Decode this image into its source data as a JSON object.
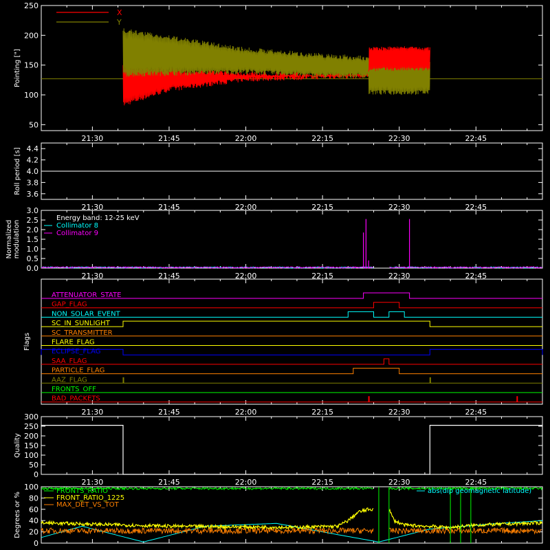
{
  "time_ticks": [
    "21:30",
    "21:45",
    "22:00",
    "22:15",
    "22:30",
    "22:45"
  ],
  "chart_data": [
    {
      "id": "pointing",
      "type": "line",
      "ylabel": "Pointing [\"]",
      "yticks": [
        50,
        100,
        150,
        200,
        250
      ],
      "ylim": [
        40,
        250
      ],
      "legend": [
        {
          "label": "X",
          "color": "#ff0000"
        },
        {
          "label": "Y",
          "color": "#808000"
        }
      ],
      "baseline_value": 127,
      "data_window": [
        "21:36",
        "22:36"
      ],
      "envelope": {
        "x": [
          "21:36",
          "21:45",
          "22:00",
          "22:15",
          "22:24",
          "22:24",
          "22:31",
          "22:36"
        ],
        "X_min": [
          80,
          105,
          122,
          126,
          128,
          140,
          140,
          140
        ],
        "X_max": [
          150,
          145,
          140,
          138,
          140,
          180,
          182,
          180
        ],
        "Y_min": [
          130,
          132,
          135,
          128,
          128,
          100,
          100,
          100
        ],
        "Y_max": [
          212,
          200,
          180,
          170,
          165,
          160,
          158,
          158
        ]
      }
    },
    {
      "id": "roll",
      "type": "line",
      "ylabel": "Roll period [s]",
      "yticks": [
        "3.6",
        "3.8",
        "4.0",
        "4.2",
        "4.4"
      ],
      "ylim": [
        3.5,
        4.5
      ],
      "series": [
        {
          "values_x": [
            "21:20",
            "22:58"
          ],
          "values_y": [
            4.0,
            4.0
          ],
          "color": "#ffffff"
        }
      ]
    },
    {
      "id": "modulation",
      "type": "line",
      "ylabel": "Normalized modulation",
      "yticks": [
        "0.0",
        "0.5",
        "1.0",
        "1.5",
        "2.0",
        "2.5",
        "3.0"
      ],
      "ylim": [
        0,
        3
      ],
      "legend": [
        {
          "label": "Energy band: 12-25 keV",
          "color": "#ffffff"
        },
        {
          "label": "Collimator 8",
          "color": "#00ffff"
        },
        {
          "label": "Collimator 9",
          "color": "#ff00ff"
        }
      ],
      "spikes": [
        {
          "x": "22:23",
          "y": 1.85,
          "color": "#ff00ff"
        },
        {
          "x": "22:23.5",
          "y": 2.55,
          "color": "#ff00ff"
        },
        {
          "x": "22:24",
          "y": 0.4,
          "color": "#ff00ff"
        },
        {
          "x": "22:32",
          "y": 2.55,
          "color": "#ff00ff"
        }
      ],
      "gap": [
        "22:25",
        "22:28"
      ],
      "noise_level": 0.05
    },
    {
      "id": "flags",
      "type": "line",
      "ylabel": "Flags",
      "rows": [
        {
          "label": "ATTENUATOR_STATE",
          "color": "#ff00ff",
          "high": [
            [
              "22:23",
              "22:32"
            ]
          ]
        },
        {
          "label": "GAP_FLAG",
          "color": "#ff0000",
          "high": [
            [
              "22:25",
              "22:30"
            ]
          ]
        },
        {
          "label": "NON_SOLAR_EVENT",
          "color": "#00ffff",
          "high": [
            [
              "22:20",
              "22:25"
            ],
            [
              "22:28",
              "22:31"
            ]
          ]
        },
        {
          "label": "SC_IN_SUNLIGHT",
          "color": "#ffff00",
          "high": [
            [
              "21:36",
              "22:36"
            ]
          ]
        },
        {
          "label": "SC_TRANSMITTER",
          "color": "#ff8000",
          "high": []
        },
        {
          "label": "FLARE_FLAG",
          "color": "#ffff00",
          "high": []
        },
        {
          "label": "ECLIPSE_FLAG",
          "color": "#0000ff",
          "high": [
            [
              "21:20",
              "21:36"
            ],
            [
              "22:36",
              "22:58"
            ]
          ]
        },
        {
          "label": "SAA_FLAG",
          "color": "#ff0000",
          "high": [
            [
              "22:27",
              "22:28"
            ]
          ]
        },
        {
          "label": "PARTICLE_FLAG",
          "color": "#ff8000",
          "high": [
            [
              "22:21",
              "22:30"
            ]
          ]
        },
        {
          "label": "AAZ_FLAG",
          "color": "#808000",
          "pulses": [
            "21:36",
            "22:36"
          ]
        },
        {
          "label": "FRONTS_OFF",
          "color": "#00ff00",
          "high": []
        },
        {
          "label": "BAD_PACKETS",
          "color": "#ff0000",
          "pulses": [
            "22:24",
            "22:53"
          ]
        }
      ]
    },
    {
      "id": "quality",
      "type": "line",
      "ylabel": "Quality",
      "yticks": [
        0,
        50,
        100,
        150,
        200,
        250,
        300
      ],
      "ylim": [
        0,
        300
      ],
      "series": [
        {
          "values_x": [
            "21:20",
            "21:36",
            "21:36",
            "22:36",
            "22:36",
            "22:58"
          ],
          "values_y": [
            255,
            255,
            0,
            0,
            255,
            255
          ],
          "color": "#ffffff"
        }
      ]
    },
    {
      "id": "degrees",
      "type": "line",
      "ylabel": "Degrees or %",
      "yticks": [
        0,
        20,
        40,
        60,
        80,
        100
      ],
      "ylim": [
        0,
        100
      ],
      "legend": [
        {
          "label": "FRONTS_RATIO",
          "color": "#00ff00"
        },
        {
          "label": "FRONT_RATIO_1225",
          "color": "#ffff00"
        },
        {
          "label": "MAX_DET_VS_TOT",
          "color": "#ff8000"
        }
      ],
      "right_legend": {
        "label": "abs(dip geomagnetic latitude)",
        "color": "#00ffff"
      },
      "gap": [
        "22:25",
        "22:28"
      ],
      "fronts_ratio_level": 97,
      "max_det_level": 22,
      "front_ratio_1225": {
        "x": [
          "21:20",
          "21:45",
          "22:10",
          "22:18",
          "22:20",
          "22:22",
          "22:24",
          "22:25",
          "22:28",
          "22:29",
          "22:31",
          "22:40",
          "22:45",
          "22:58"
        ],
        "y": [
          36,
          30,
          28,
          30,
          40,
          55,
          60,
          60,
          60,
          40,
          32,
          28,
          32,
          36
        ]
      },
      "dip_latitude": {
        "x": [
          "21:20",
          "21:28",
          "21:40",
          "21:52",
          "22:06",
          "22:18",
          "22:26",
          "22:36",
          "22:48",
          "22:58"
        ],
        "y": [
          10,
          30,
          2,
          30,
          35,
          15,
          2,
          25,
          34,
          40
        ]
      },
      "fronts_ratio_drops": [
        "22:26",
        "22:28",
        "22:40",
        "22:42",
        "22:44"
      ]
    }
  ]
}
